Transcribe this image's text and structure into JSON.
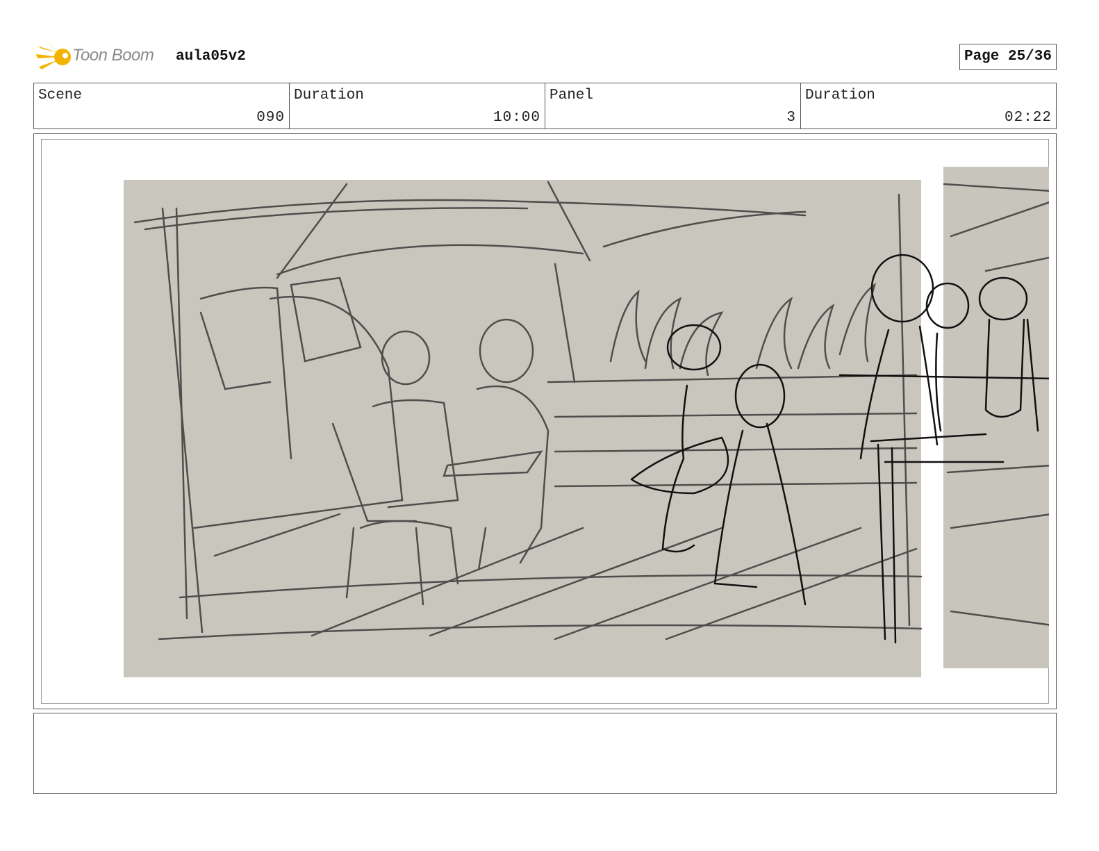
{
  "header": {
    "brand": "Toon Boom",
    "project": "aula05v2",
    "page": "Page 25/36"
  },
  "info": {
    "scene_label": "Scene",
    "scene_value": "090",
    "scene_duration_label": "Duration",
    "scene_duration_value": "10:00",
    "panel_label": "Panel",
    "panel_value": "3",
    "panel_duration_label": "Duration",
    "panel_duration_value": "02:22"
  },
  "colors": {
    "logo": "#f2b400",
    "paper": "#c9c6bd",
    "pencil": "#3a3a3a",
    "ink": "#111111"
  }
}
